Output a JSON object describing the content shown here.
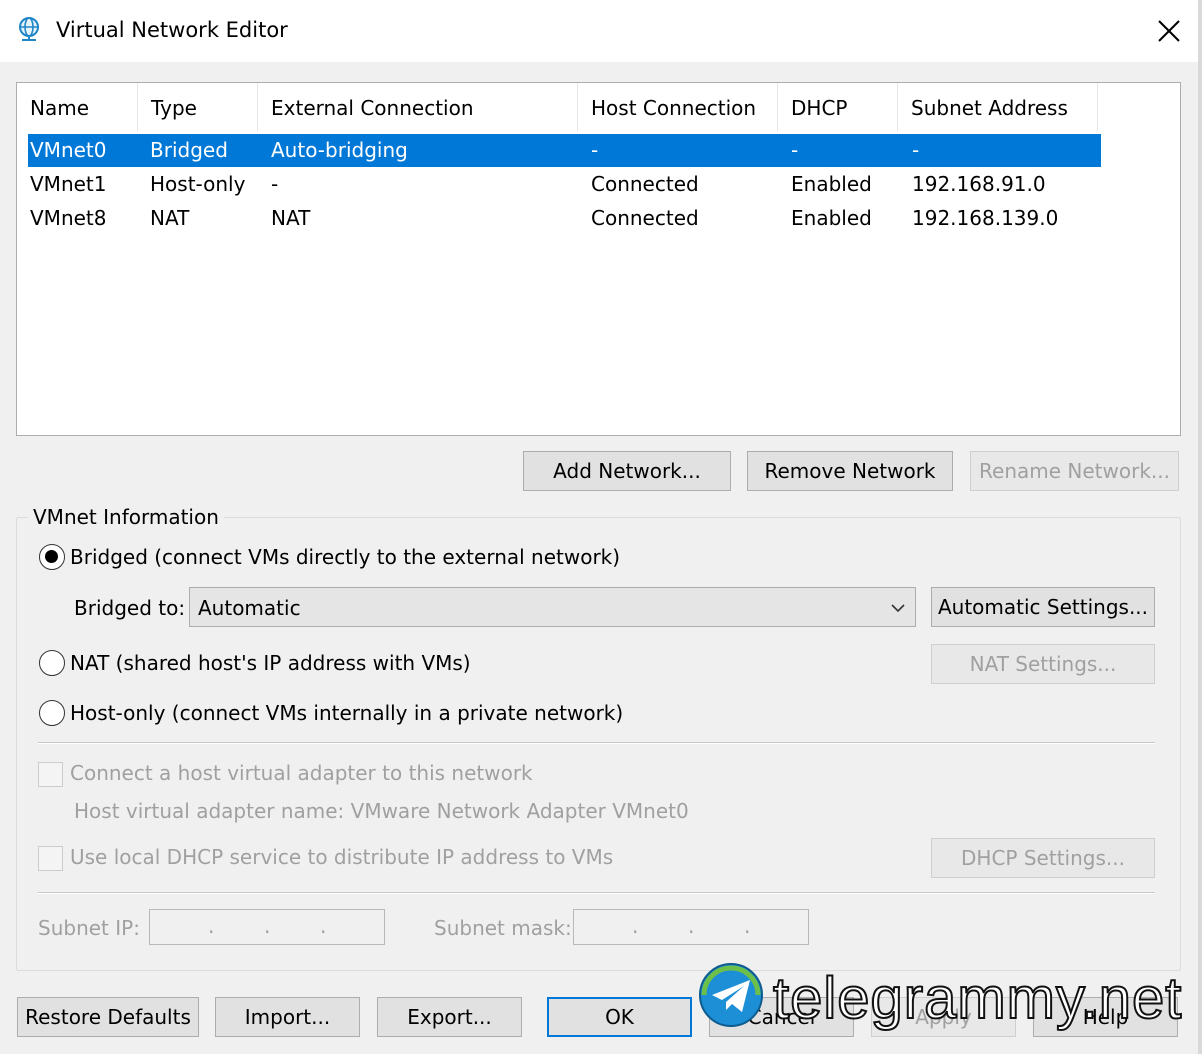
{
  "window": {
    "title": "Virtual Network Editor",
    "icon": "globe-network-icon",
    "close_icon": "close-icon"
  },
  "table": {
    "columns": [
      "Name",
      "Type",
      "External Connection",
      "Host Connection",
      "DHCP",
      "Subnet Address"
    ],
    "rows": [
      {
        "name": "VMnet0",
        "type": "Bridged",
        "external": "Auto-bridging",
        "host": "-",
        "dhcp": "-",
        "subnet": "-",
        "selected": true
      },
      {
        "name": "VMnet1",
        "type": "Host-only",
        "external": "-",
        "host": "Connected",
        "dhcp": "Enabled",
        "subnet": "192.168.91.0",
        "selected": false
      },
      {
        "name": "VMnet8",
        "type": "NAT",
        "external": "NAT",
        "host": "Connected",
        "dhcp": "Enabled",
        "subnet": "192.168.139.0",
        "selected": false
      }
    ]
  },
  "network_buttons": {
    "add": "Add Network...",
    "remove": "Remove Network",
    "rename": "Rename Network..."
  },
  "vmnet_info": {
    "title": "VMnet Information",
    "bridged_label": "Bridged (connect VMs directly to the external network)",
    "bridged_to_label": "Bridged to:",
    "bridged_to_value": "Automatic",
    "auto_settings": "Automatic Settings...",
    "nat_label": "NAT (shared host's IP address with VMs)",
    "nat_settings": "NAT Settings...",
    "hostonly_label": "Host-only (connect VMs internally in a private network)",
    "connect_adapter_label": "Connect a host virtual adapter to this network",
    "adapter_name_text": "Host virtual adapter name: VMware Network Adapter VMnet0",
    "dhcp_label": "Use local DHCP service to distribute IP address to VMs",
    "dhcp_settings": "DHCP Settings...",
    "subnet_ip_label": "Subnet IP:",
    "subnet_mask_label": "Subnet mask:",
    "selected_mode": "bridged"
  },
  "footer": {
    "restore": "Restore Defaults",
    "import": "Import...",
    "export": "Export...",
    "ok": "OK",
    "cancel": "Cancel",
    "apply": "Apply",
    "help": "Help"
  },
  "watermark": {
    "text": "telegrammy.net",
    "icon": "telegram-logo-icon"
  },
  "colors": {
    "selection": "#0078d7",
    "background": "#f0f0f0",
    "disabled_text": "#a0a0a0"
  }
}
